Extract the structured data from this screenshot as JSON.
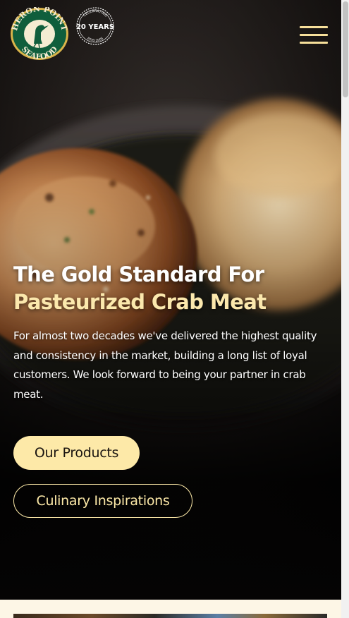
{
  "header": {
    "logo": {
      "top_text": "HERON POINT",
      "bottom_text": "SEAFOOD",
      "icon": "heron-icon"
    },
    "anniversary_badge": {
      "top_text": "CELEBRATING",
      "main_text": "20 YEARS",
      "bottom_text": "ESTD 2005"
    },
    "menu_icon": "hamburger-menu-icon"
  },
  "hero": {
    "headline_line1": "The Gold Standard For",
    "headline_line2": "Pasteurized Crab Meat",
    "intro": "For almost two decades we've delivered the highest quality and consistency in the market, building a long list of loyal customers. We look forward to being your partner in crab meat.",
    "primary_button": "Our Products",
    "secondary_button": "Culinary Inspirations"
  },
  "colors": {
    "accent_gold": "#fde9a8",
    "headline_gold": "#fbe8ad",
    "logo_green": "#0f5e3c",
    "logo_gold": "#d9b44a",
    "page_cream": "#fdf6e6"
  }
}
